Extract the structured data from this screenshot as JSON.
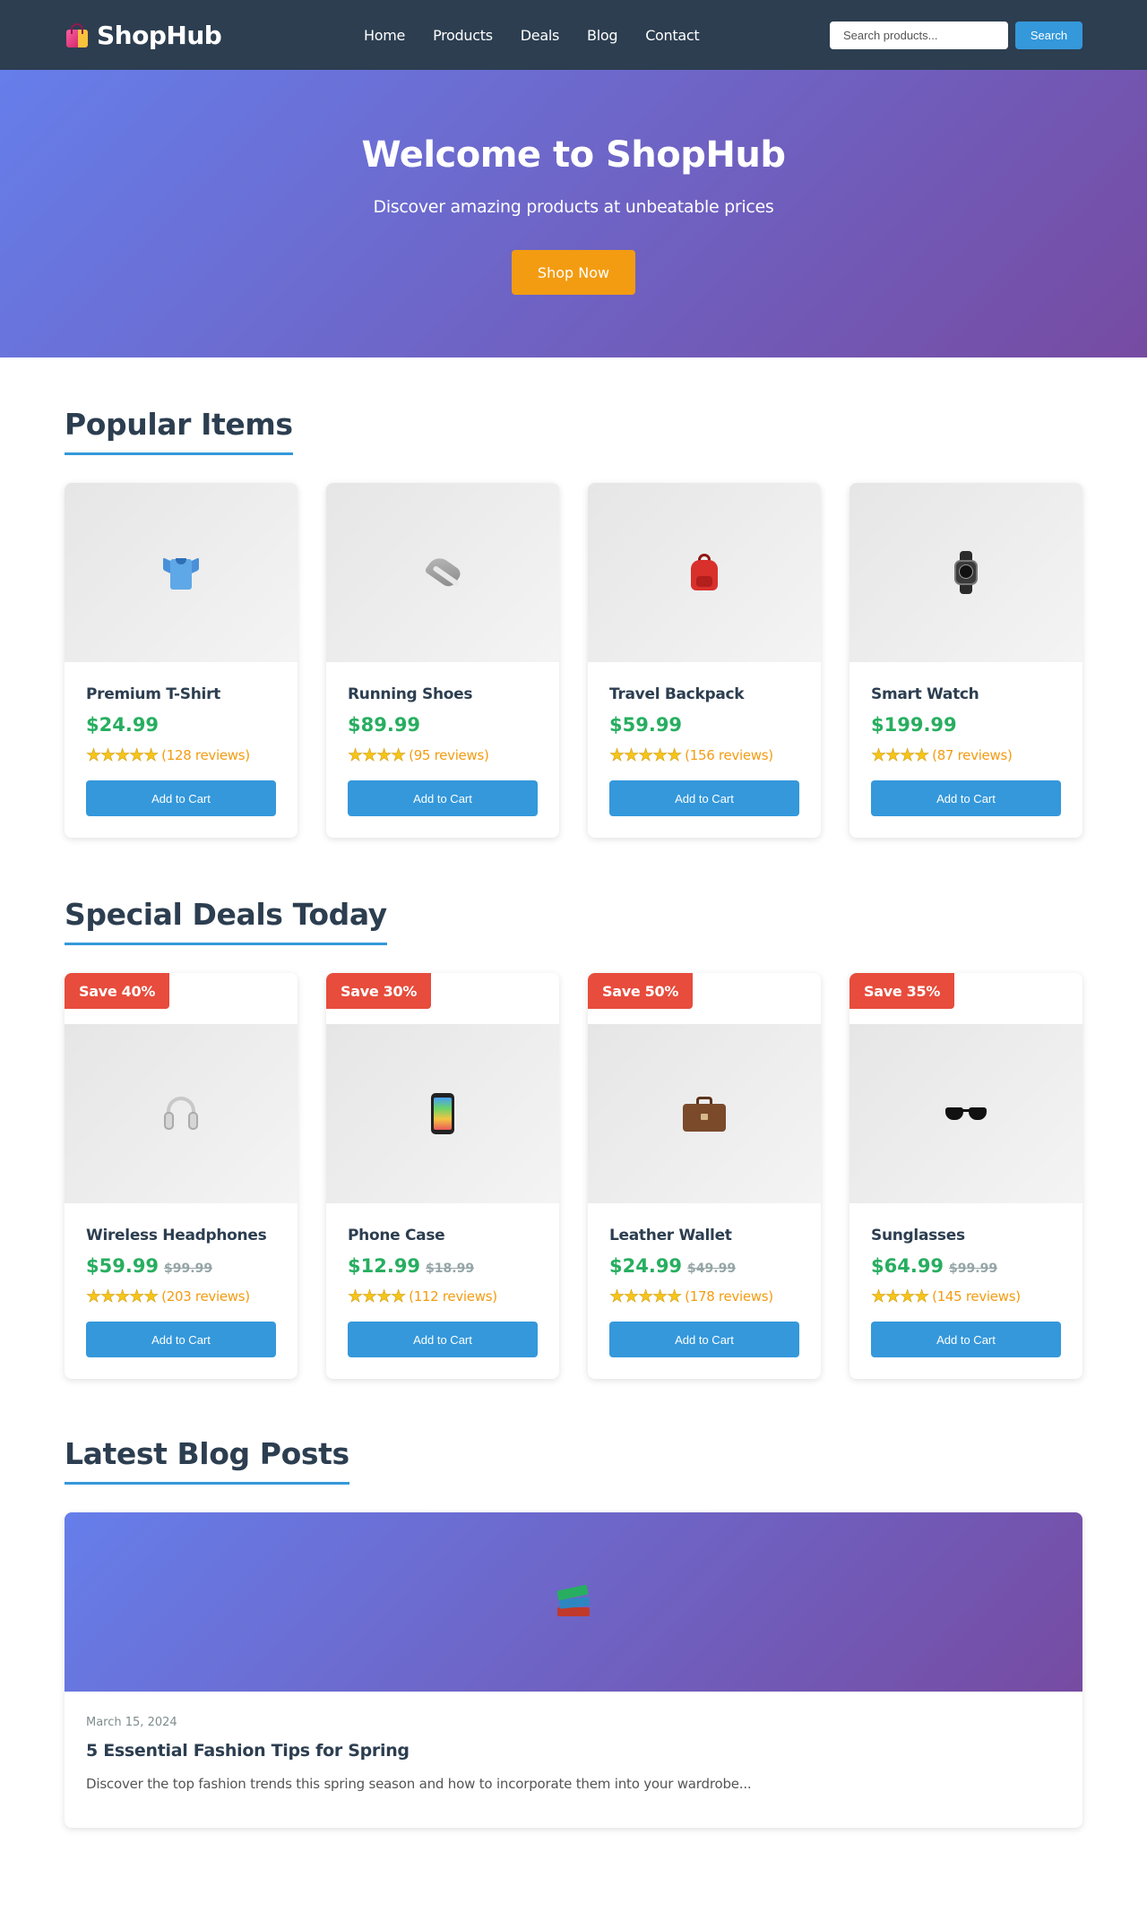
{
  "header": {
    "logo_text": "ShopHub",
    "nav": [
      "Home",
      "Products",
      "Deals",
      "Blog",
      "Contact"
    ],
    "search_placeholder": "Search products...",
    "search_button": "Search"
  },
  "hero": {
    "title": "Welcome to ShopHub",
    "subtitle": "Discover amazing products at unbeatable prices",
    "cta": "Shop Now"
  },
  "popular": {
    "title": "Popular Items",
    "items": [
      {
        "name": "Premium T-Shirt",
        "price": "$24.99",
        "reviews": "(128 reviews)",
        "stars": "★★★★★",
        "icon": "t-shirt-icon",
        "button": "Add to Cart"
      },
      {
        "name": "Running Shoes",
        "price": "$89.99",
        "reviews": "(95 reviews)",
        "stars": "★★★★",
        "icon": "running-shoe-icon",
        "button": "Add to Cart"
      },
      {
        "name": "Travel Backpack",
        "price": "$59.99",
        "reviews": "(156 reviews)",
        "stars": "★★★★★",
        "icon": "backpack-icon",
        "button": "Add to Cart"
      },
      {
        "name": "Smart Watch",
        "price": "$199.99",
        "reviews": "(87 reviews)",
        "stars": "★★★★",
        "icon": "watch-icon",
        "button": "Add to Cart"
      }
    ]
  },
  "deals": {
    "title": "Special Deals Today",
    "items": [
      {
        "badge": "Save 40%",
        "name": "Wireless Headphones",
        "price": "$59.99",
        "old_price": "$99.99",
        "reviews": "(203 reviews)",
        "stars": "★★★★★",
        "icon": "headphones-icon",
        "button": "Add to Cart"
      },
      {
        "badge": "Save 30%",
        "name": "Phone Case",
        "price": "$12.99",
        "old_price": "$18.99",
        "reviews": "(112 reviews)",
        "stars": "★★★★",
        "icon": "mobile-phone-icon",
        "button": "Add to Cart"
      },
      {
        "badge": "Save 50%",
        "name": "Leather Wallet",
        "price": "$24.99",
        "old_price": "$49.99",
        "reviews": "(178 reviews)",
        "stars": "★★★★★",
        "icon": "briefcase-icon",
        "button": "Add to Cart"
      },
      {
        "badge": "Save 35%",
        "name": "Sunglasses",
        "price": "$64.99",
        "old_price": "$99.99",
        "reviews": "(145 reviews)",
        "stars": "★★★★",
        "icon": "sunglasses-icon",
        "button": "Add to Cart"
      }
    ]
  },
  "blog": {
    "title": "Latest Blog Posts",
    "posts": [
      {
        "date": "March 15, 2024",
        "title": "5 Essential Fashion Tips for Spring",
        "excerpt": "Discover the top fashion trends this spring season and how to incorporate them into your wardrobe...",
        "icon": "books-icon"
      }
    ]
  },
  "colors": {
    "header_bg": "#2c3e50",
    "accent": "#3498db",
    "price": "#27ae60",
    "badge": "#e74c3c",
    "cta": "#f39c12",
    "hero_gradient_start": "#667eea",
    "hero_gradient_end": "#764ba2"
  }
}
